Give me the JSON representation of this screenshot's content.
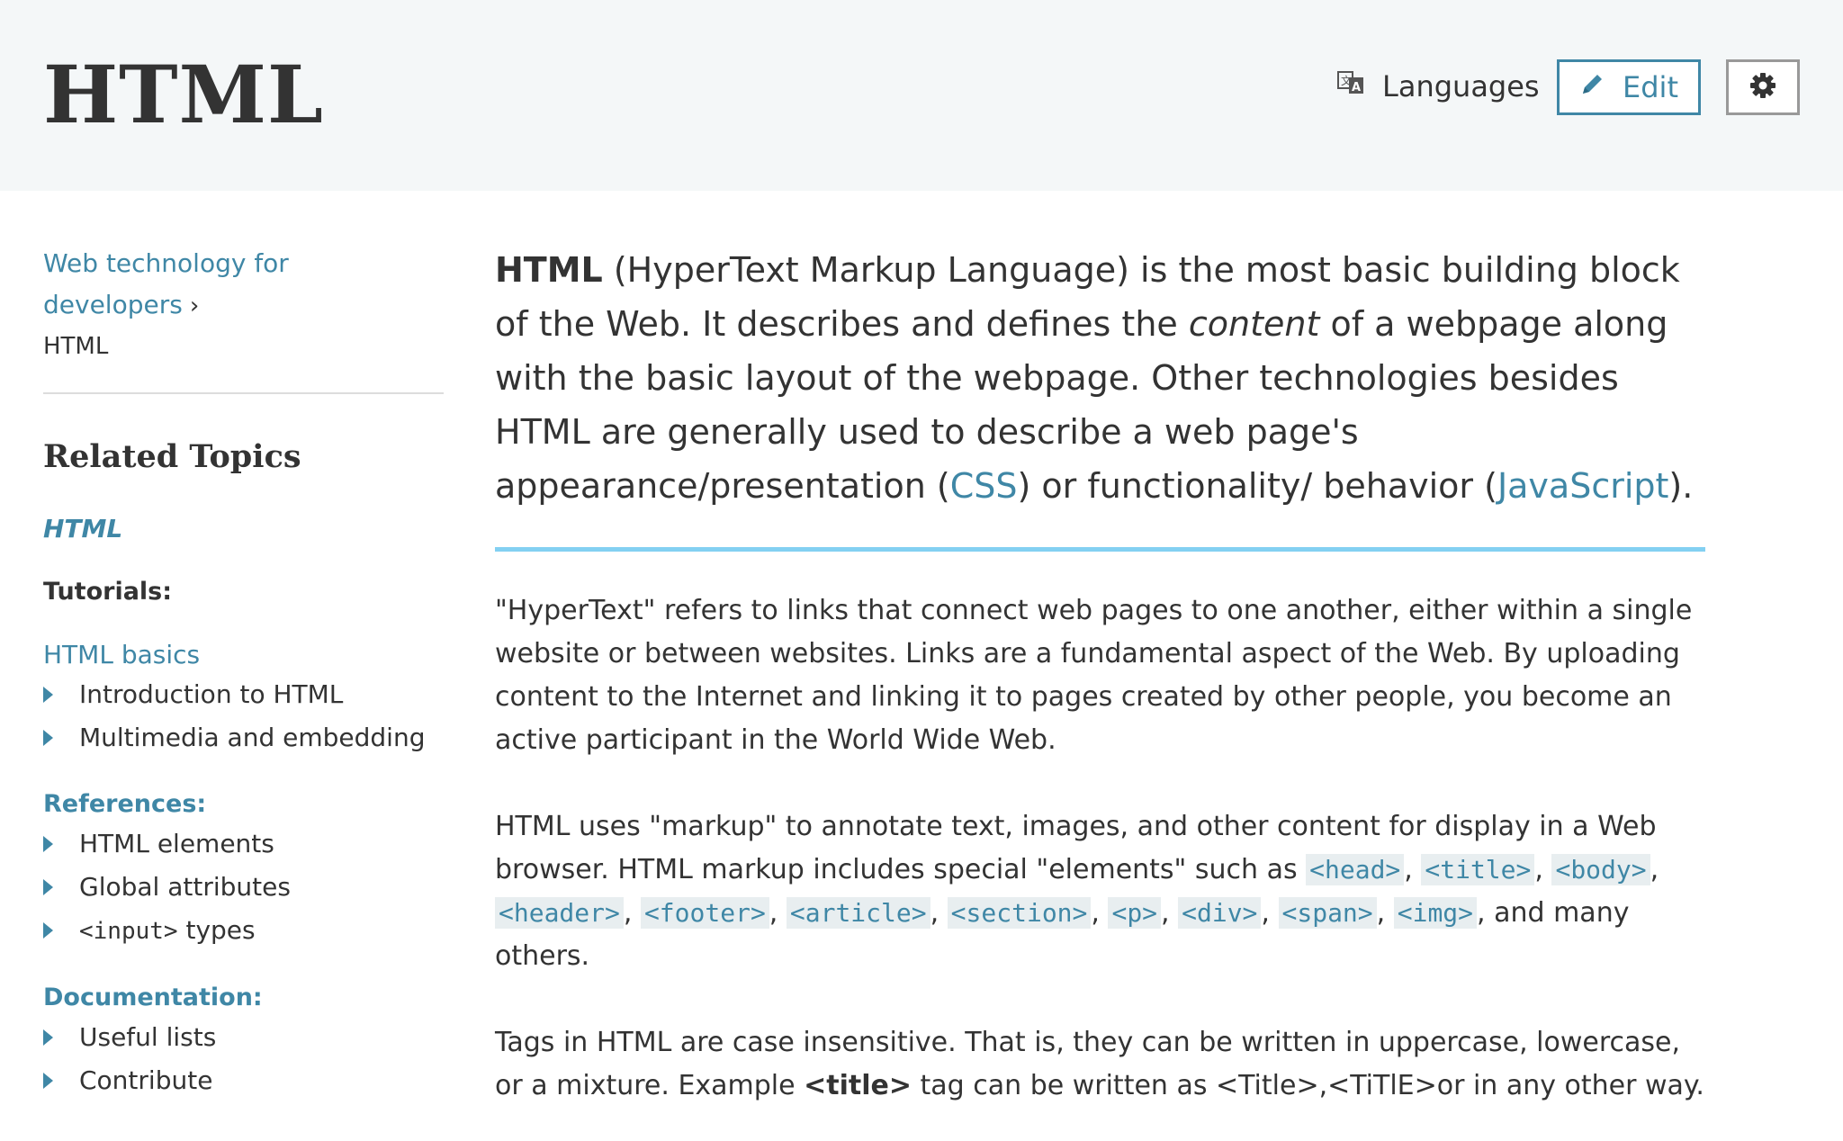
{
  "header": {
    "title": "HTML",
    "languages_label": "Languages",
    "edit_label": "Edit",
    "icons": {
      "languages": "translate-icon",
      "edit": "pencil-icon",
      "settings": "gear-icon"
    }
  },
  "colors": {
    "accent": "#3f87a6",
    "header_bg": "#f4f7f8",
    "rule": "#83d0f2",
    "text": "#333333"
  },
  "sidebar": {
    "breadcrumb_link": "Web technology for developers",
    "breadcrumb_separator": "›",
    "breadcrumb_current": "HTML",
    "related_title": "Related Topics",
    "topic_link": "HTML",
    "tutorials_heading": "Tutorials:",
    "basics_link": "HTML basics",
    "basics_items": [
      "Introduction to HTML",
      "Multimedia and embedding"
    ],
    "references_heading": "References:",
    "reference_items": [
      "HTML elements",
      "Global attributes",
      "<input>",
      " types"
    ],
    "documentation_heading": "Documentation:",
    "documentation_items": [
      "Useful lists",
      "Contribute"
    ]
  },
  "main": {
    "lead": {
      "bold": "HTML",
      "part1": " (HyperText Markup Language) is the most basic building block of the Web. It describes and defines the ",
      "italic": "content",
      "part2": " of a webpage along with the basic layout of the webpage. Other technologies besides HTML are generally used to describe a web page's appearance/presentation (",
      "css_link": "CSS",
      "part3": ") or functionality/ behavior (",
      "js_link": "JavaScript",
      "part4": ")."
    },
    "para1": "\"HyperText\" refers to links that connect web pages to one another, either within a single website or between websites. Links are a fundamental aspect of the Web. By uploading content to the Internet and linking it to pages created by other people, you become an active participant in the World Wide Web.",
    "para2": {
      "text1": "HTML uses \"markup\" to annotate text, images, and other content for display in a Web browser. HTML markup includes special \"elements\" such as ",
      "tags": [
        "<head>",
        "<title>",
        "<body>",
        "<header>",
        "<footer>",
        "<article>",
        "<section>",
        "<p>",
        "<div>",
        "<span>",
        "<img>"
      ],
      "sep": ", ",
      "text2": ", and many others."
    },
    "para3": {
      "text1": "Tags in HTML are case insensitive. That is, they can be written in uppercase, lowercase, or a mixture. Example ",
      "bold": "<title>",
      "text2": " tag can be written as <Title>,<TiTlE>or in any other way."
    }
  }
}
